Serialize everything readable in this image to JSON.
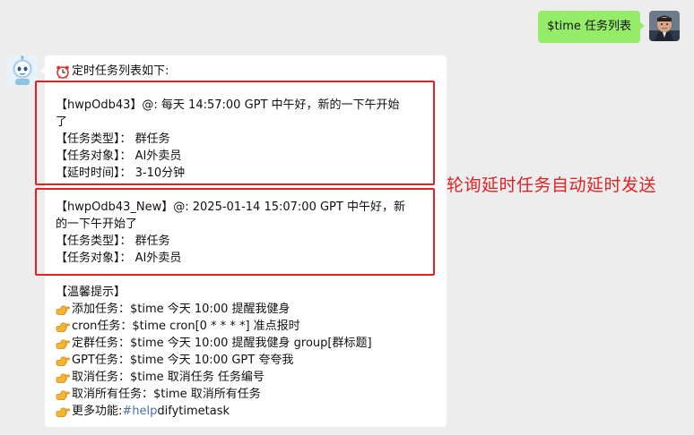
{
  "outgoing": {
    "text": "$time 任务列表"
  },
  "incoming": {
    "header": "定时任务列表如下:",
    "tasks": [
      {
        "line1": "【hwpOdb43】@: 每天 14:57:00 GPT 中午好，新的一下午开始",
        "line1b": "了",
        "type": "【任务类型】： 群任务",
        "target": "【任务对象】： AI外卖员",
        "delay": "【延时时间】： 3-10分钟"
      },
      {
        "line1": "【hwpOdb43_New】@: 2025-01-14 15:07:00 GPT 中午好，新",
        "line1b": "的一下午开始了",
        "type": "【任务类型】： 群任务",
        "target": "【任务对象】： AI外卖员"
      }
    ],
    "tips_title": "【温馨提示】",
    "tips": [
      "添加任务：$time 今天 10:00 提醒我健身",
      "cron任务：$time cron[0 * * * *] 准点报时",
      "定群任务：$time 今天 10:00 提醒我健身 group[群标题]",
      "GPT任务：$time 今天 10:00 GPT 夸夸我",
      "取消任务：$time 取消任务 任务编号",
      "取消所有任务：$time 取消所有任务"
    ],
    "more_prefix": "更多功能: ",
    "more_link": "#help",
    "more_suffix": " difytimetask"
  },
  "annotation": "轮询延时任务自动延时发送",
  "colors": {
    "background": "#ededed",
    "outgoing_bubble": "#95ec69",
    "incoming_bubble": "#ffffff",
    "highlight": "#e02222",
    "link": "#4a6fa5"
  },
  "icons": {
    "alarm": "alarm-clock-icon",
    "hand": "pointing-hand-icon"
  }
}
